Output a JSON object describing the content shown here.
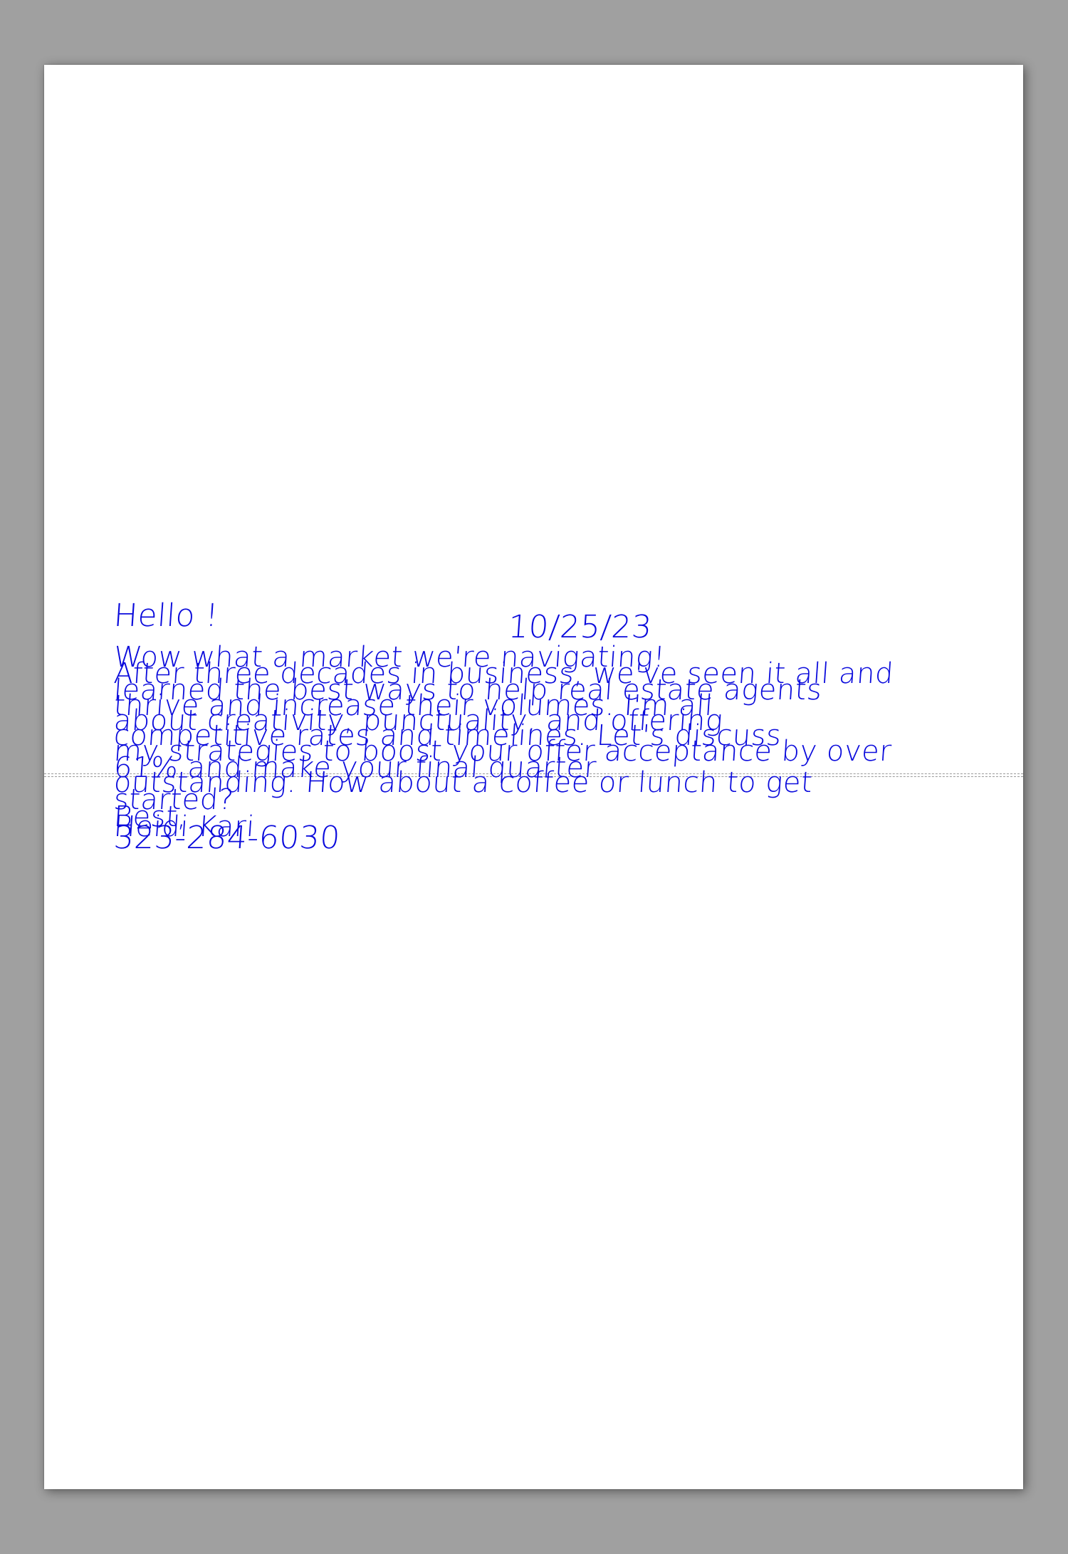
{
  "ink_color": "#0a0adc",
  "letter": {
    "greeting": "Hello !",
    "date": "10/25/23",
    "lines": [
      "Wow what a market we're navigating!",
      "After three decades in business, we've seen it all and",
      "learned the best ways to help real estate agents",
      "thrive and increase their volumes. I'm all",
      "about creativity, punctuality, and offering",
      "competitive rates and timelines. Let's discuss",
      "my strategies to boost your offer acceptance by over",
      "61% and make your final quarter",
      "outstanding. How about a coffee or lunch to get",
      "started?"
    ],
    "closing": "Best,",
    "name": "Heidi Kari",
    "phone": "323-284-6030"
  }
}
